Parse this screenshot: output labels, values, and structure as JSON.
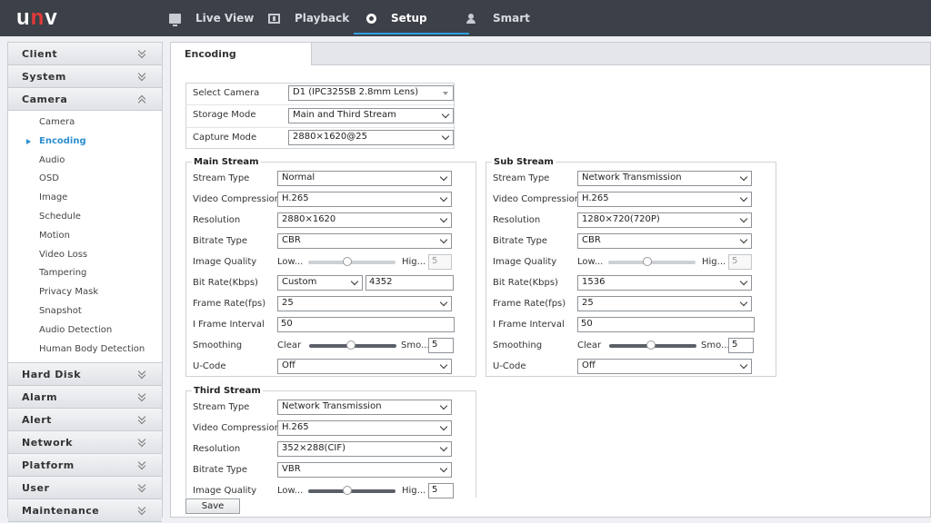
{
  "brand": {
    "logo_text": "unv"
  },
  "nav": [
    {
      "label": "Live View"
    },
    {
      "label": "Playback"
    },
    {
      "label": "Setup"
    },
    {
      "label": "Smart"
    }
  ],
  "sidebar": {
    "sections": [
      "Client",
      "System",
      "Camera"
    ],
    "camera_items": [
      "Camera",
      "Encoding",
      "Audio",
      "OSD",
      "Image",
      "Schedule",
      "Motion",
      "Video Loss",
      "Tampering",
      "Privacy Mask",
      "Snapshot",
      "Audio Detection",
      "Human Body Detection"
    ],
    "bottom_sections": [
      "Hard Disk",
      "Alarm",
      "Alert",
      "Network",
      "Platform",
      "User",
      "Maintenance"
    ]
  },
  "tab": {
    "label": "Encoding"
  },
  "top": {
    "select_camera_label": "Select Camera",
    "select_camera_value": "D1 (IPC325SB 2.8mm Lens)",
    "storage_mode_label": "Storage Mode",
    "storage_mode_value": "Main and Third Stream",
    "capture_mode_label": "Capture Mode",
    "capture_mode_value": "2880×1620@25"
  },
  "labels": {
    "stream_type": "Stream Type",
    "video_compression": "Video Compression",
    "resolution": "Resolution",
    "bitrate_type": "Bitrate Type",
    "image_quality": "Image Quality",
    "bit_rate": "Bit Rate(Kbps)",
    "frame_rate": "Frame Rate(fps)",
    "i_frame": "I Frame Interval",
    "smoothing": "Smoothing",
    "u_code": "U-Code",
    "low": "Low...",
    "high": "Hig...",
    "clear": "Clear",
    "smooth": "Smo..."
  },
  "main_stream": {
    "title": "Main Stream",
    "stream_type": "Normal",
    "video_compression": "H.265",
    "resolution": "2880×1620",
    "bitrate_type": "CBR",
    "image_quality_value": "5",
    "image_quality_level": 0.45,
    "bit_rate_mode": "Custom",
    "bit_rate_value": "4352",
    "frame_rate": "25",
    "i_frame": "50",
    "smoothing_value": "5",
    "smoothing_level": 0.48,
    "u_code": "Off"
  },
  "sub_stream": {
    "title": "Sub Stream",
    "stream_type": "Network Transmission",
    "video_compression": "H.265",
    "resolution": "1280×720(720P)",
    "bitrate_type": "CBR",
    "image_quality_value": "5",
    "image_quality_level": 0.45,
    "bit_rate": "1536",
    "frame_rate": "25",
    "i_frame": "50",
    "smoothing_value": "5",
    "smoothing_level": 0.48,
    "u_code": "Off"
  },
  "third_stream": {
    "title": "Third Stream",
    "stream_type": "Network Transmission",
    "video_compression": "H.265",
    "resolution": "352×288(CIF)",
    "bitrate_type": "VBR",
    "image_quality_value": "5",
    "image_quality_level": 0.45
  },
  "save_label": "Save",
  "colors": {
    "topbar": "#3c4048",
    "accent": "#2d9fe0",
    "logo_accent": "#e23a3a"
  }
}
